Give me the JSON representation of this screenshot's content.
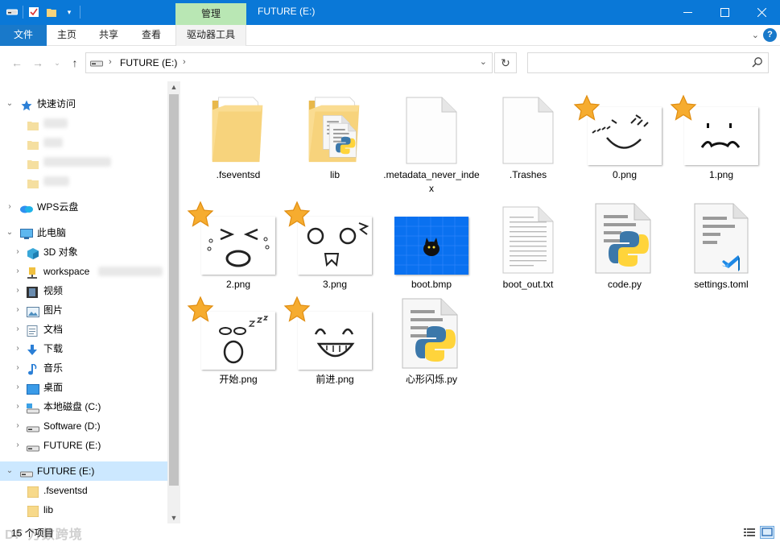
{
  "window": {
    "title": "FUTURE (E:)",
    "context_tab": "管理"
  },
  "ribbon": {
    "tabs": [
      "文件",
      "主页",
      "共享",
      "查看",
      "驱动器工具"
    ]
  },
  "address": {
    "path": "FUTURE (E:)",
    "search_placeholder": ""
  },
  "sidebar": {
    "quick_access": "快速访问",
    "wps": "WPS云盘",
    "this_pc": "此电脑",
    "pc_items": [
      "3D 对象",
      "workspace",
      "视频",
      "图片",
      "文档",
      "下载",
      "音乐",
      "桌面",
      "本地磁盘 (C:)",
      "Software (D:)",
      "FUTURE (E:)"
    ],
    "selected_drive": "FUTURE (E:)",
    "drive_children": [
      ".fseventsd",
      "lib"
    ]
  },
  "files": [
    {
      "name": ".fseventsd",
      "kind": "folder-empty"
    },
    {
      "name": "lib",
      "kind": "folder-python"
    },
    {
      "name": ".metadata_never_index",
      "kind": "blank-doc"
    },
    {
      "name": ".Trashes",
      "kind": "blank-doc"
    },
    {
      "name": "0.png",
      "kind": "image-face0",
      "starred": true
    },
    {
      "name": "1.png",
      "kind": "image-face1",
      "starred": true
    },
    {
      "name": "2.png",
      "kind": "image-face2",
      "starred": true
    },
    {
      "name": "3.png",
      "kind": "image-face3",
      "starred": true
    },
    {
      "name": "boot.bmp",
      "kind": "image-bmp"
    },
    {
      "name": "boot_out.txt",
      "kind": "text-doc"
    },
    {
      "name": "code.py",
      "kind": "python-file"
    },
    {
      "name": "settings.toml",
      "kind": "toml-file"
    },
    {
      "name": "开始.png",
      "kind": "image-face-sleep",
      "starred": true
    },
    {
      "name": "前进.png",
      "kind": "image-face-smile",
      "starred": true
    },
    {
      "name": "心形闪烁.py",
      "kind": "python-file"
    }
  ],
  "status": {
    "item_count": "15 个项目",
    "watermark": "DF 万数跨境"
  },
  "colors": {
    "titlebar": "#0a78d7",
    "context_tab": "#b9e7b4",
    "selection": "#cce8ff",
    "star": "#f5a623"
  }
}
